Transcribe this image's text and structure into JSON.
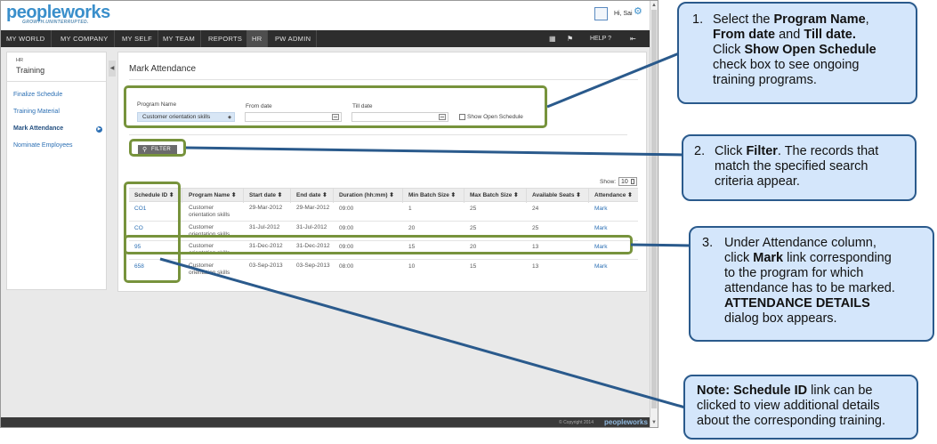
{
  "app": {
    "logo_text": "peopleworks",
    "tagline": "GROWTH.UNINTERRUPTED.",
    "greeting": "Hi, Sai",
    "nav": [
      "MY WORLD",
      "MY COMPANY",
      "MY SELF",
      "MY TEAM",
      "REPORTS",
      "HR",
      "PW ADMIN"
    ],
    "active_nav": "HR",
    "help_label": "HELP"
  },
  "sidebar": {
    "module": "HR",
    "title": "Training",
    "items": [
      "Finalize Schedule",
      "Training Material",
      "Mark Attendance",
      "Nominate Employees"
    ],
    "active_item": "Mark Attendance"
  },
  "content": {
    "title": "Mark Attendance",
    "filters": {
      "program_label": "Program Name",
      "program_value": "Customer orientation skills",
      "from_label": "From date",
      "till_label": "Till date",
      "open_schedule_label": "Show Open Schedule",
      "filter_button": "FILTER"
    },
    "show_label": "Show:",
    "show_value": "10",
    "columns": [
      "Schedule ID",
      "Program Name",
      "Start date",
      "End date",
      "Duration (hh:mm)",
      "Min Batch Size",
      "Max Batch Size",
      "Available Seats",
      "Attendance"
    ],
    "rows": [
      {
        "id": "CO1",
        "program": "Customer orientation skills",
        "start": "29-Mar-2012",
        "end": "29-Mar-2012",
        "duration": "09:00",
        "min": "1",
        "max": "25",
        "seats": "24",
        "attendance": "Mark"
      },
      {
        "id": "CO",
        "program": "Customer orientation skills",
        "start": "31-Jul-2012",
        "end": "31-Jul-2012",
        "duration": "09:00",
        "min": "20",
        "max": "25",
        "seats": "25",
        "attendance": "Mark"
      },
      {
        "id": "95",
        "program": "Customer orientation skills",
        "start": "31-Dec-2012",
        "end": "31-Dec-2012",
        "duration": "09:00",
        "min": "15",
        "max": "20",
        "seats": "13",
        "attendance": "Mark"
      },
      {
        "id": "658",
        "program": "Customer orientation skills",
        "start": "03-Sep-2013",
        "end": "03-Sep-2013",
        "duration": "08:00",
        "min": "10",
        "max": "15",
        "seats": "13",
        "attendance": "Mark"
      }
    ]
  },
  "footer": {
    "copyright": "© Copyright 2014",
    "logo": "peopleworks"
  },
  "callouts": {
    "c1": {
      "num": "1.",
      "t1": "Select the ",
      "b1": "Program Name",
      "t2": ",",
      "b2": "From date",
      "t3": " and ",
      "b3": "Till date.",
      "t4": "Click ",
      "b4": "Show Open Schedule",
      "t5": "check box to see ongoing",
      "t6": "training programs."
    },
    "c2": {
      "num": "2.",
      "t1": "Click ",
      "b1": "Filter",
      "t2": ". The records that",
      "t3": "match the specified search",
      "t4": "criteria appear."
    },
    "c3": {
      "num": "3.",
      "t1": "Under Attendance column,",
      "t2": "click ",
      "b1": "Mark",
      "t3": " link corresponding",
      "t4": "to the program for which",
      "t5": "attendance has to be marked.",
      "b2": "ATTENDANCE DETAILS",
      "t6": "dialog box appears."
    },
    "c4": {
      "b1": "Note:",
      "b2": " Schedule ID",
      "t1": " link can be",
      "t2": "clicked to view additional details",
      "t3": "about the corresponding training."
    }
  },
  "colors": {
    "highlight": "#77933c",
    "callout_bg": "#d4e6fb",
    "callout_border": "#2a5a8c",
    "nav_bg": "#2d2d2d",
    "link": "#2b6fb4"
  }
}
